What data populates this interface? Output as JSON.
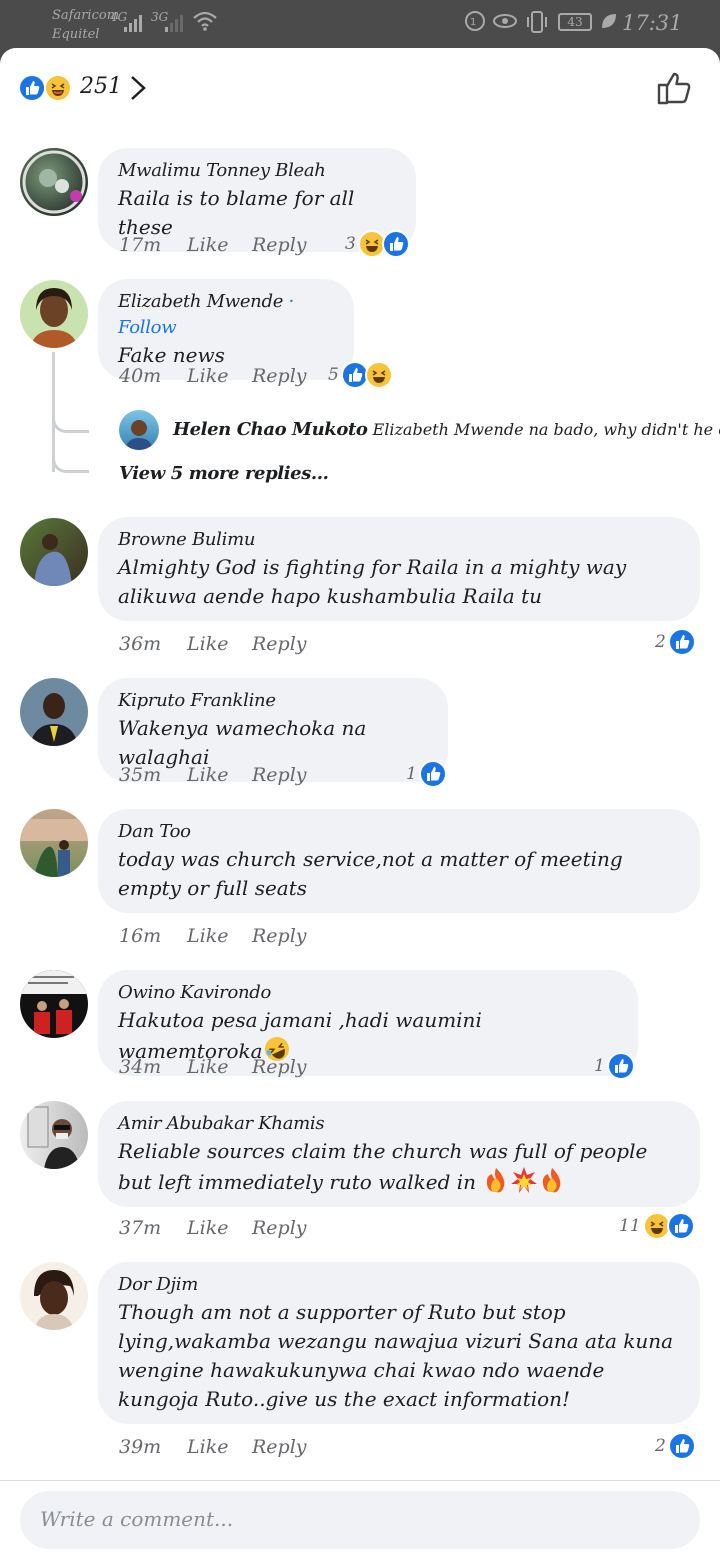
{
  "status_bar": {
    "carrier_1": "Safaricom",
    "carrier_2": "Equitel",
    "network_1": "4G",
    "network_2": "3G",
    "battery": "43",
    "time": "17:31"
  },
  "header": {
    "reaction_count": "251",
    "reaction_icons": [
      "like-icon",
      "haha-icon"
    ],
    "action_icon": "thumbs-up-outline-icon"
  },
  "comments": [
    {
      "name": "Mwalimu Tonney Bleah",
      "text": "Raila is to blame for all these",
      "time": "17m",
      "like": "Like",
      "reply": "Reply",
      "reactions": "3",
      "reaction_icons": [
        "haha-icon",
        "like-icon"
      ]
    },
    {
      "name": "Elizabeth Mwende",
      "follow": "· Follow",
      "text": "Fake news",
      "time": "40m",
      "like": "Like",
      "reply": "Reply",
      "reactions": "5",
      "reaction_icons": [
        "like-icon",
        "haha-icon"
      ],
      "reply_preview": {
        "name": "Helen Chao Mukoto",
        "text": "Elizabeth Mwende na bado, why didn't he c..."
      },
      "more_replies": "View 5 more replies..."
    },
    {
      "name": "Browne Bulimu",
      "text": "Almighty God is fighting for Raila in a mighty way alikuwa aende hapo kushambulia Raila tu",
      "time": "36m",
      "like": "Like",
      "reply": "Reply",
      "reactions": "2",
      "reaction_icons": [
        "like-icon"
      ]
    },
    {
      "name": "Kipruto Frankline",
      "text": "Wakenya wamechoka na walaghai",
      "time": "35m",
      "like": "Like",
      "reply": "Reply",
      "reactions": "1",
      "reaction_icons": [
        "like-icon"
      ]
    },
    {
      "name": "Dan Too",
      "text": "today was church service,not a matter of meeting empty or full seats",
      "time": "16m",
      "like": "Like",
      "reply": "Reply"
    },
    {
      "name": "Owino Kavirondo",
      "text": "Hakutoa pesa jamani ,hadi waumini wamemtoroka",
      "emoji": [
        "rofl-emoji"
      ],
      "time": "34m",
      "like": "Like",
      "reply": "Reply",
      "reactions": "1",
      "reaction_icons": [
        "like-icon"
      ]
    },
    {
      "name": "Amir Abubakar Khamis",
      "text": "Reliable sources claim the church was full of people but left immediately ruto walked in ",
      "emoji": [
        "fire-emoji",
        "collision-emoji",
        "fire-emoji"
      ],
      "time": "37m",
      "like": "Like",
      "reply": "Reply",
      "reactions": "11",
      "reaction_icons": [
        "haha-icon",
        "like-icon"
      ]
    },
    {
      "name": "Dor Djim",
      "text": "Though am not a supporter of Ruto but stop lying,wakamba wezangu nawajua vizuri Sana ata kuna wengine hawakukunywa chai kwao ndo waende kungoja Ruto..give us the exact information!",
      "time": "39m",
      "like": "Like",
      "reply": "Reply",
      "reactions": "2",
      "reaction_icons": [
        "like-icon"
      ]
    }
  ],
  "composer": {
    "placeholder": "Write a comment..."
  },
  "colors": {
    "accent": "#1b74e4",
    "bubble": "#f0f2f5",
    "haha": "#f7c33b",
    "meta": "#65676b"
  }
}
